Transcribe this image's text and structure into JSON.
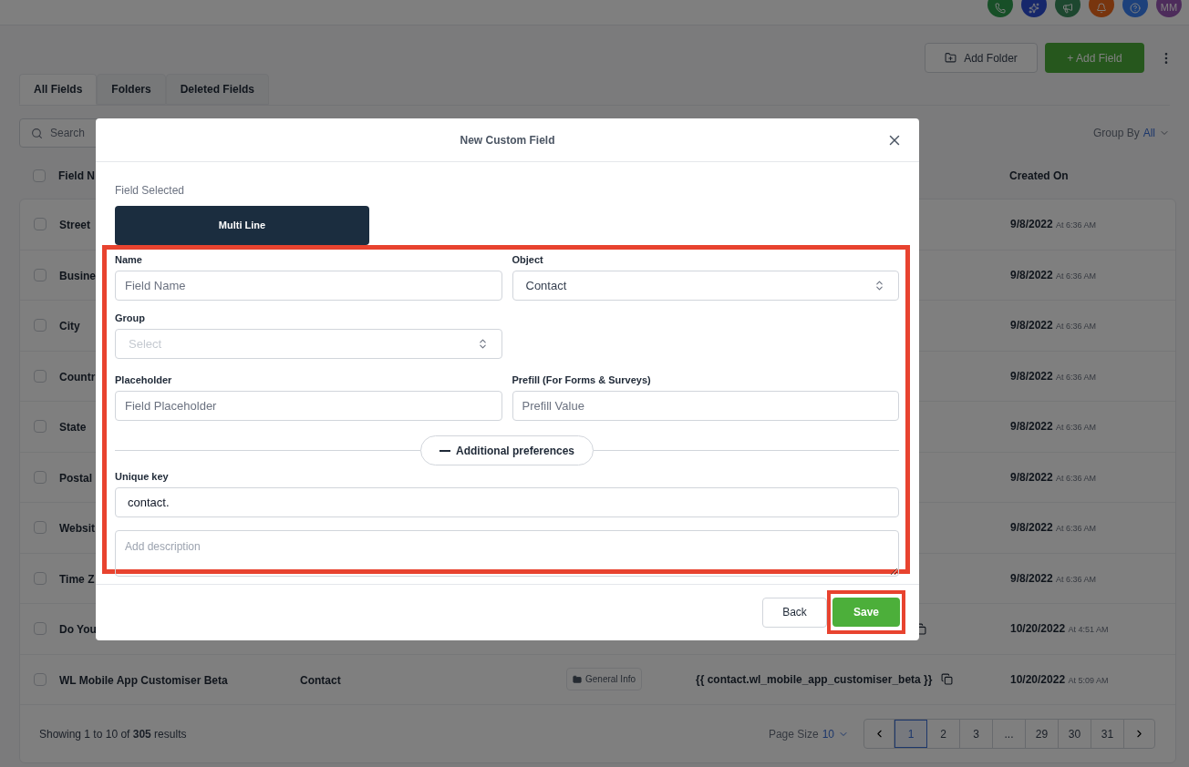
{
  "top_bar": {
    "avatar": "MM"
  },
  "toolbar": {
    "add_folder": "Add Folder",
    "add_field": "+ Add Field"
  },
  "tabs": [
    {
      "label": "All Fields",
      "selected": true
    },
    {
      "label": "Folders",
      "selected": false
    },
    {
      "label": "Deleted Fields",
      "selected": false
    }
  ],
  "search": {
    "placeholder": "Search"
  },
  "group_by": {
    "label": "Group By",
    "value": "All"
  },
  "table": {
    "columns": [
      "Field N",
      "Created On"
    ],
    "select_all_checked": false,
    "rows": [
      {
        "checked": false,
        "name": "Street",
        "date": "9/8/2022",
        "time": "At 6:36 AM"
      },
      {
        "checked": false,
        "name": "Busine",
        "date": "9/8/2022",
        "time": "At 6:36 AM"
      },
      {
        "checked": false,
        "name": "City",
        "date": "9/8/2022",
        "time": "At 6:36 AM"
      },
      {
        "checked": false,
        "name": "Countr",
        "date": "9/8/2022",
        "time": "At 6:36 AM"
      },
      {
        "checked": false,
        "name": "State",
        "date": "9/8/2022",
        "time": "At 6:36 AM"
      },
      {
        "checked": false,
        "name": "Postal",
        "date": "9/8/2022",
        "time": "At 6:36 AM"
      },
      {
        "checked": false,
        "name": "Websit",
        "date": "9/8/2022",
        "time": "At 6:36 AM"
      },
      {
        "checked": false,
        "name": "Time Z",
        "date": "9/8/2022",
        "time": "At 6:36 AM"
      },
      {
        "checked": false,
        "name": "Do You",
        "copy_icon": true,
        "date": "10/20/2022",
        "time": "At 4:51 AM"
      },
      {
        "checked": false,
        "name": "WL Mobile App Customiser Beta",
        "object": "Contact",
        "folder": "General Info",
        "key": "{{ contact.wl_mobile_app_customiser_beta }}",
        "copy_icon": true,
        "date": "10/20/2022",
        "time": "At 5:09 AM"
      }
    ]
  },
  "footer": {
    "summary": "Showing 1 to 10 of **305** results",
    "page_size_label": "Page Size",
    "page_size": "10",
    "pages": [
      {
        "label": "1",
        "selected": true
      },
      {
        "label": "2",
        "selected": false
      },
      {
        "label": "3",
        "selected": false
      },
      {
        "label": "...",
        "selected": false
      },
      {
        "label": "29",
        "selected": false
      },
      {
        "label": "30",
        "selected": false
      },
      {
        "label": "31",
        "selected": false
      }
    ]
  },
  "modal": {
    "title": "New Custom Field",
    "field_selected_label": "Field Selected",
    "field_type": "Multi Line",
    "name": {
      "label": "Name",
      "placeholder": "Field Name"
    },
    "object": {
      "label": "Object",
      "value": "Contact"
    },
    "group": {
      "label": "Group",
      "placeholder": "Select"
    },
    "placeholder_field": {
      "label": "Placeholder",
      "placeholder": "Field Placeholder"
    },
    "prefill": {
      "label": "Prefill (For Forms & Surveys)",
      "placeholder": "Prefill Value"
    },
    "additional_preferences": {
      "label": "Additional preferences",
      "expanded": true
    },
    "unique_key": {
      "label": "Unique key",
      "value": "contact."
    },
    "description": {
      "placeholder": "Add description"
    },
    "buttons": {
      "back": "Back",
      "save": "Save"
    }
  }
}
